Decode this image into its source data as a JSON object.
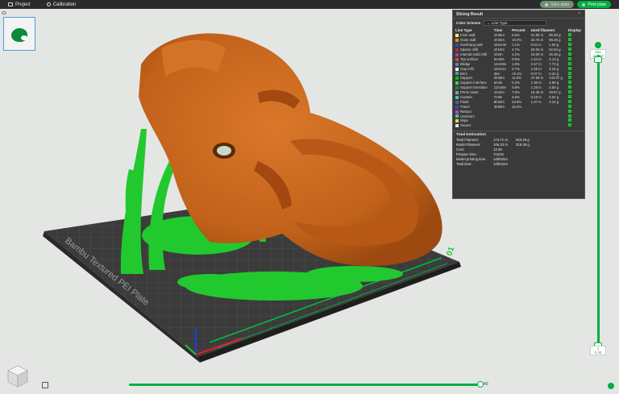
{
  "topbar": {
    "tabs": [
      {
        "label": "Project",
        "icon": "project-icon"
      },
      {
        "label": "Calibration",
        "icon": "gear-icon"
      }
    ],
    "slice_label": "Slice plate",
    "print_label": "Print plate"
  },
  "plate_text": {
    "name": "Bambu Textured PEI Plate",
    "number": "01"
  },
  "slicing": {
    "title": "Slicing Result",
    "color_scheme_label": "Color Scheme",
    "color_scheme_value": "Line Type",
    "headers": [
      "Line Type",
      "Time",
      "Percent",
      "Used filament",
      "Display"
    ],
    "rows": [
      {
        "name": "Inner wall",
        "time": "1h36m",
        "pct": "6.5%",
        "len": "31.90 m",
        "wt": "95.90 g",
        "color": "#ffe680"
      },
      {
        "name": "Outer wall",
        "time": "2h30m",
        "pct": "10.2%",
        "len": "32.76 m",
        "wt": "98.49 g",
        "color": "#ff8c00"
      },
      {
        "name": "Overhang wall",
        "time": "16m14s",
        "pct": "1.1%",
        "len": "0.64 m",
        "wt": "1.93 g",
        "color": "#2050d0"
      },
      {
        "name": "Sparse infill",
        "time": "1h10m",
        "pct": "4.7%",
        "len": "20.93 m",
        "wt": "62.94 g",
        "color": "#b03030"
      },
      {
        "name": "Internal solid infill",
        "time": "1h2m",
        "pct": "4.2%",
        "len": "15.09 m",
        "wt": "45.36 g",
        "color": "#a040c0"
      },
      {
        "name": "Top surface",
        "time": "6m45s",
        "pct": "0.5%",
        "len": "1.04 m",
        "wt": "3.13 g",
        "color": "#e04040"
      },
      {
        "name": "Bridge",
        "time": "14m29s",
        "pct": "1.0%",
        "len": "2.57 m",
        "wt": "7.73 g",
        "color": "#5080c0"
      },
      {
        "name": "Gap infill",
        "time": "10m11s",
        "pct": "0.7%",
        "len": "1.05 m",
        "wt": "3.15 g",
        "color": "#ffffff"
      },
      {
        "name": "Brim",
        "time": "35s",
        "pct": "<0.1%",
        "len": "0.07 m",
        "wt": "0.22 g",
        "color": "#40a0a0"
      },
      {
        "name": "Support",
        "time": "2h49m",
        "pct": "11.5%",
        "len": "47.59 m",
        "wt": "143.07 g",
        "color": "#00c000"
      },
      {
        "name": "Support interface",
        "time": "5m3s",
        "pct": "0.3%",
        "len": "1.30 m",
        "wt": "3.90 g",
        "color": "#40d040"
      },
      {
        "name": "Support transition",
        "time": "11m26s",
        "pct": "0.8%",
        "len": "1.28 m",
        "wt": "3.83 g",
        "color": "#208040"
      },
      {
        "name": "Prime tower",
        "time": "1h44m",
        "pct": "7.0%",
        "len": "16.25 m",
        "wt": "48.87 g",
        "color": "#80a0a0"
      },
      {
        "name": "Custom",
        "time": "7m8s",
        "pct": "0.5%",
        "len": "0.18 m",
        "wt": "0.54 g",
        "color": "#50c0a0"
      },
      {
        "name": "Flush",
        "time": "8h32m",
        "pct": "34.8%",
        "len": "1.07 m",
        "wt": "3.22 g",
        "color": "#606060"
      },
      {
        "name": "Travel",
        "time": "3h59m",
        "pct": "16.2%",
        "len": "",
        "wt": "",
        "color": "#4040c0"
      },
      {
        "name": "Retract",
        "time": "",
        "pct": "",
        "len": "",
        "wt": "",
        "color": "#c040c0"
      },
      {
        "name": "Unretract",
        "time": "",
        "pct": "",
        "len": "",
        "wt": "",
        "color": "#40c0c0"
      },
      {
        "name": "Wipe",
        "time": "",
        "pct": "",
        "len": "",
        "wt": "",
        "color": "#e0e040"
      },
      {
        "name": "Seams",
        "time": "",
        "pct": "",
        "len": "",
        "wt": "",
        "color": "#e0e0e0"
      }
    ],
    "total_title": "Total Estimation",
    "totals": [
      {
        "k": "Total Filament:",
        "v1": "173.71 m",
        "v2": "522.29 g"
      },
      {
        "k": "Model Filament:",
        "v1": "106.23 m",
        "v2": "319.39 g"
      },
      {
        "k": "Cost:",
        "v1": "13.05",
        "v2": ""
      },
      {
        "k": "Prepare time:",
        "v1": "7m23s",
        "v2": ""
      },
      {
        "k": "Model printing time:",
        "v1": "1d0h25m",
        "v2": ""
      },
      {
        "k": "Total time:",
        "v1": "1d0h32m",
        "v2": ""
      }
    ]
  },
  "layer_slider": {
    "top_layer": "552",
    "top_height": "165.60",
    "bottom_layer": "1",
    "bottom_height": "0.30"
  },
  "move_slider": {
    "value": "40"
  },
  "colors": {
    "accent": "#00ae42",
    "model": "#c86a1c",
    "support": "#22c92e"
  }
}
